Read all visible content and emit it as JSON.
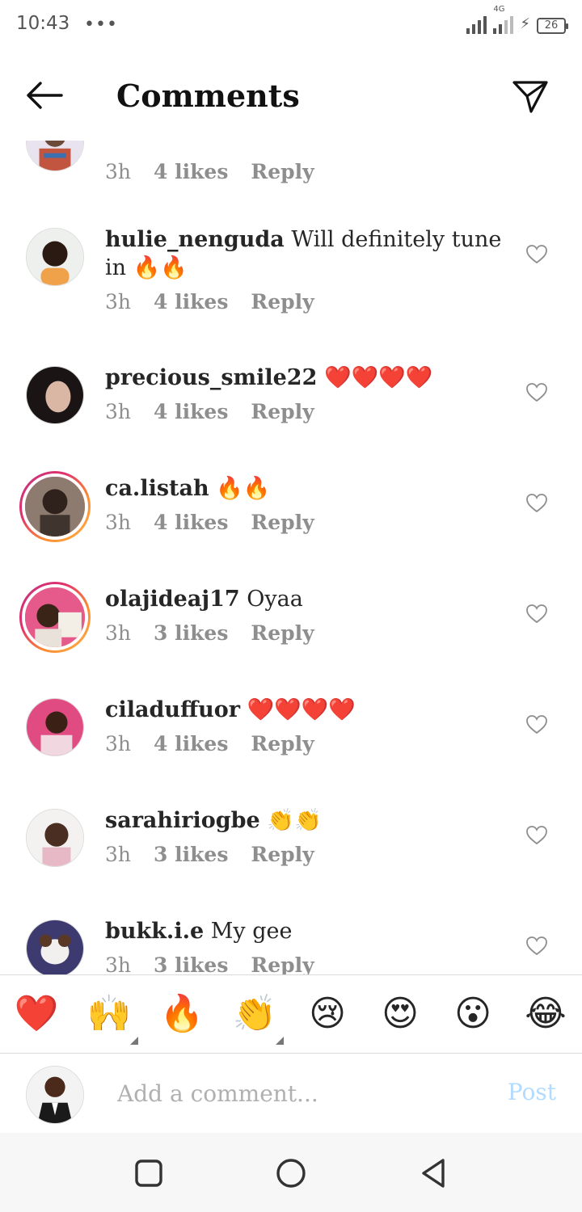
{
  "status_bar": {
    "time": "10:43",
    "dots": "•••",
    "network_label": "4G",
    "battery_level": "26"
  },
  "header": {
    "title": "Comments"
  },
  "comments": [
    {
      "username": "",
      "text": "",
      "time": "3h",
      "likes": "4 likes",
      "reply": "Reply",
      "emoji": "",
      "avatar": "partial"
    },
    {
      "username": "hulie_nenguda",
      "text": "Will definitely tune in",
      "emoji": "🔥🔥",
      "time": "3h",
      "likes": "4 likes",
      "reply": "Reply"
    },
    {
      "username": "precious_smile22",
      "text": "",
      "emoji": "❤️❤️❤️❤️",
      "time": "3h",
      "likes": "4 likes",
      "reply": "Reply"
    },
    {
      "username": "ca.listah",
      "text": "",
      "emoji": "🔥🔥",
      "time": "3h",
      "likes": "4 likes",
      "reply": "Reply"
    },
    {
      "username": "olajideaj17",
      "text": "Oyaa",
      "emoji": "",
      "time": "3h",
      "likes": "3 likes",
      "reply": "Reply"
    },
    {
      "username": "ciladuffuor",
      "text": "",
      "emoji": "❤️❤️❤️❤️",
      "time": "3h",
      "likes": "4 likes",
      "reply": "Reply"
    },
    {
      "username": "sarahiriogbe",
      "text": "",
      "emoji": "👏👏",
      "time": "3h",
      "likes": "3 likes",
      "reply": "Reply"
    },
    {
      "username": "bukk.i.e",
      "text": "My gee",
      "emoji": "",
      "time": "3h",
      "likes": "3 likes",
      "reply": "Reply"
    }
  ],
  "emoji_bar": [
    "❤️",
    "🙌",
    "🔥",
    "👏",
    "😢",
    "😍",
    "😮",
    "😂"
  ],
  "composer": {
    "placeholder": "Add a comment...",
    "post_label": "Post"
  },
  "colors": {
    "like_heart": "#ed4956",
    "story_ring_start": "#c13584",
    "story_ring_end": "#fcaf45",
    "post_disabled": "#b3dbff",
    "meta_gray": "#8e8e8e"
  }
}
